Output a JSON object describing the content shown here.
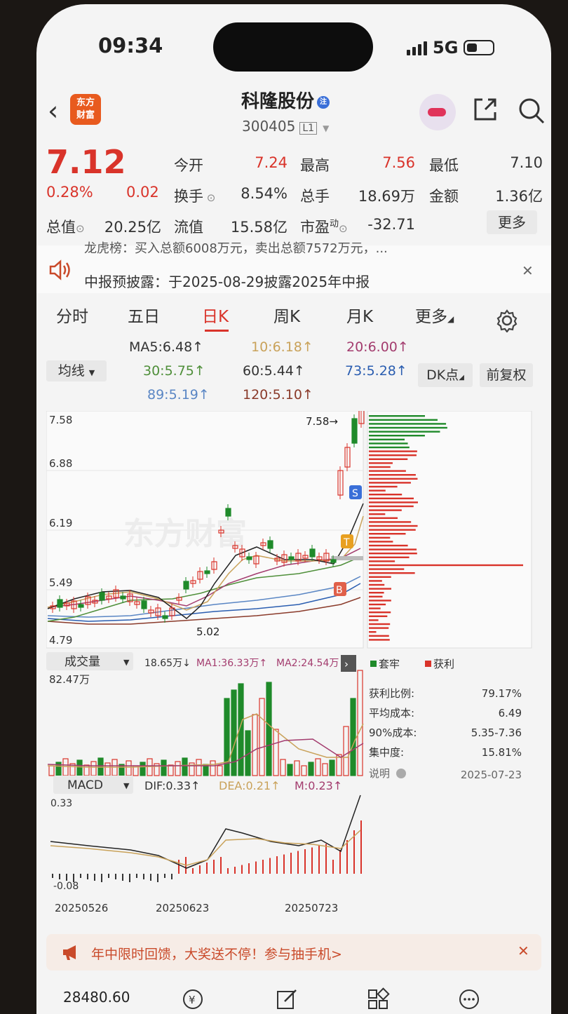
{
  "status_bar": {
    "time": "09:34",
    "network": "5G"
  },
  "header": {
    "logo_line1": "东方",
    "logo_line2": "财富",
    "stock_name": "科隆股份",
    "reg_badge": "注",
    "stock_code": "300405",
    "level": "L1"
  },
  "quote": {
    "price": "7.12",
    "change_pct": "0.28%",
    "change_amt": "0.02",
    "fields": [
      {
        "label": "今开",
        "value": "7.24"
      },
      {
        "label": "最高",
        "value": "7.56"
      },
      {
        "label": "最低",
        "value": "7.10"
      },
      {
        "label": "换手",
        "value": "8.54%"
      },
      {
        "label": "总手",
        "value": "18.69万"
      },
      {
        "label": "金额",
        "value": "1.36亿"
      },
      {
        "label": "总值",
        "value": "20.25亿"
      },
      {
        "label": "流值",
        "value": "15.58亿"
      },
      {
        "label": "市盈",
        "value": "-32.71"
      }
    ],
    "pe_super": "动",
    "more": "更多"
  },
  "notice": {
    "cut_line": "龙虎榜：买入总额6008万元，卖出总额7572万元，...",
    "text": "中报预披露：于2025-08-29披露2025年中报"
  },
  "tabs": [
    "分时",
    "五日",
    "日K",
    "周K",
    "月K",
    "更多"
  ],
  "ma": {
    "selector": "均线",
    "lines": [
      {
        "text": "MA5:6.48↑",
        "color": "#333333"
      },
      {
        "text": "10:6.18↑",
        "color": "#c9a25a"
      },
      {
        "text": "20:6.00↑",
        "color": "#a33c6e"
      },
      {
        "text": "30:5.75↑",
        "color": "#4f8f3a"
      },
      {
        "text": "60:5.44↑",
        "color": "#333333"
      },
      {
        "text": "73:5.28↑",
        "color": "#2a5db0"
      },
      {
        "text": "89:5.19↑",
        "color": "#5a86c4"
      },
      {
        "text": "120:5.10↑",
        "color": "#8a3a2a"
      }
    ],
    "dk_button": "DK点",
    "adjust_button": "前复权"
  },
  "kline": {
    "y_ticks": [
      "7.58",
      "6.88",
      "6.19",
      "5.49",
      "4.79"
    ],
    "high_label": "7.58→",
    "low_label": "5.02",
    "markers": [
      "S",
      "T",
      "B"
    ],
    "watermark": "东方财富"
  },
  "volume": {
    "selector": "成交量",
    "vol": "18.65万↓",
    "ma1": "MA1:36.33万↑",
    "ma2": "MA2:24.54万",
    "max": "82.47万"
  },
  "macd": {
    "selector": "MACD",
    "dif": "DIF:0.33↑",
    "dea": "DEA:0.21↑",
    "m": "M:0.23↑",
    "top": "0.33",
    "bottom": "-0.08",
    "dates": [
      "20250526",
      "20250623",
      "20250723"
    ]
  },
  "chips": {
    "legend_loss": "套牢",
    "legend_profit": "获利",
    "rows": [
      {
        "label": "获利比例:",
        "value": "79.17%"
      },
      {
        "label": "平均成本:",
        "value": "6.49"
      },
      {
        "label": "90%成本:",
        "value": "5.35-7.36"
      },
      {
        "label": "集中度:",
        "value": "15.81%"
      }
    ],
    "note": "说明",
    "date": "2025-07-23"
  },
  "banner": {
    "text": "年中限时回馈，大奖送不停！参与抽手机>"
  },
  "toolbar": {
    "index_value": "28480.60"
  },
  "colors": {
    "up": "#d9332a",
    "down": "#1f8a2a",
    "accent": "#d9332a"
  }
}
